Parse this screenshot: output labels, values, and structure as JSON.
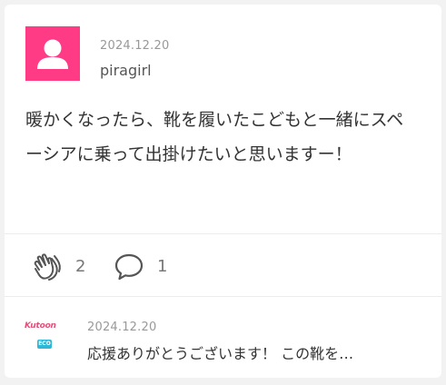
{
  "post": {
    "date": "2024.12.20",
    "username": "piragirl",
    "avatar_icon": "person-icon",
    "avatar_color": "#ff3b86",
    "body": "暖かくなったら、靴を履いたこどもと一緒にスペーシアに乗って出掛けたいと思いますー！"
  },
  "actions": {
    "clap": {
      "icon": "clap-icon",
      "count": "2"
    },
    "comment": {
      "icon": "comment-icon",
      "count": "1"
    }
  },
  "reply": {
    "logo_text": "Kutoon",
    "logo_badge": "ECO",
    "date": "2024.12.20",
    "text": "応援ありがとうございます！ この靴を…"
  }
}
